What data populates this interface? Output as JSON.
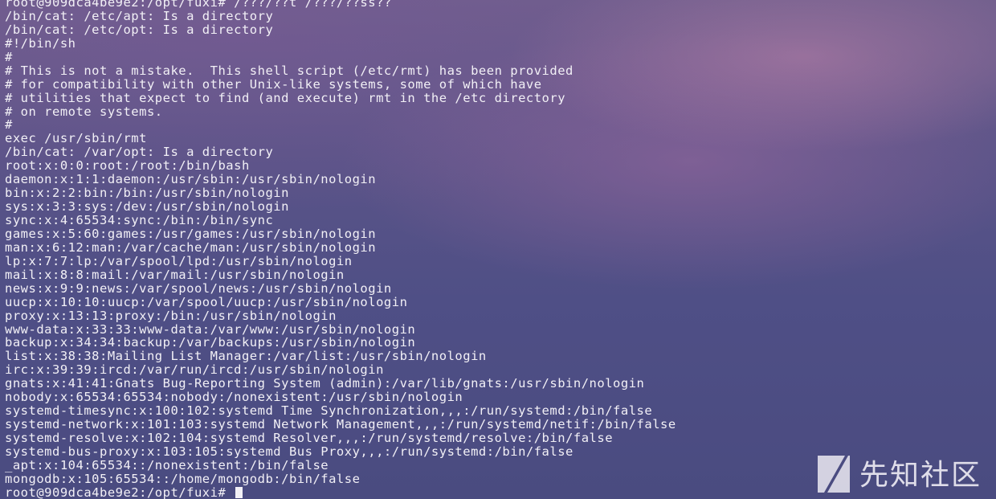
{
  "terminal": {
    "lines": [
      "root@909dca4be9e2:/opt/fuxi# /???/??t /???/??ss??",
      "/bin/cat: /etc/apt: Is a directory",
      "/bin/cat: /etc/opt: Is a directory",
      "#!/bin/sh",
      "#",
      "# This is not a mistake.  This shell script (/etc/rmt) has been provided",
      "# for compatibility with other Unix-like systems, some of which have",
      "# utilities that expect to find (and execute) rmt in the /etc directory",
      "# on remote systems.",
      "#",
      "exec /usr/sbin/rmt",
      "/bin/cat: /var/opt: Is a directory",
      "root:x:0:0:root:/root:/bin/bash",
      "daemon:x:1:1:daemon:/usr/sbin:/usr/sbin/nologin",
      "bin:x:2:2:bin:/bin:/usr/sbin/nologin",
      "sys:x:3:3:sys:/dev:/usr/sbin/nologin",
      "sync:x:4:65534:sync:/bin:/bin/sync",
      "games:x:5:60:games:/usr/games:/usr/sbin/nologin",
      "man:x:6:12:man:/var/cache/man:/usr/sbin/nologin",
      "lp:x:7:7:lp:/var/spool/lpd:/usr/sbin/nologin",
      "mail:x:8:8:mail:/var/mail:/usr/sbin/nologin",
      "news:x:9:9:news:/var/spool/news:/usr/sbin/nologin",
      "uucp:x:10:10:uucp:/var/spool/uucp:/usr/sbin/nologin",
      "proxy:x:13:13:proxy:/bin:/usr/sbin/nologin",
      "www-data:x:33:33:www-data:/var/www:/usr/sbin/nologin",
      "backup:x:34:34:backup:/var/backups:/usr/sbin/nologin",
      "list:x:38:38:Mailing List Manager:/var/list:/usr/sbin/nologin",
      "irc:x:39:39:ircd:/var/run/ircd:/usr/sbin/nologin",
      "gnats:x:41:41:Gnats Bug-Reporting System (admin):/var/lib/gnats:/usr/sbin/nologin",
      "nobody:x:65534:65534:nobody:/nonexistent:/usr/sbin/nologin",
      "systemd-timesync:x:100:102:systemd Time Synchronization,,,:/run/systemd:/bin/false",
      "systemd-network:x:101:103:systemd Network Management,,,:/run/systemd/netif:/bin/false",
      "systemd-resolve:x:102:104:systemd Resolver,,,:/run/systemd/resolve:/bin/false",
      "systemd-bus-proxy:x:103:105:systemd Bus Proxy,,,:/run/systemd:/bin/false",
      "_apt:x:104:65534::/nonexistent:/bin/false",
      "mongodb:x:105:65534::/home/mongodb:/bin/false"
    ],
    "prompt": "root@909dca4be9e2:/opt/fuxi# "
  },
  "watermark": {
    "text": "先知社区",
    "logo_icon": "xianzhi-logo-icon"
  },
  "colors": {
    "text": "#f2f0f6",
    "background_top": "#6e5e8c",
    "background_bottom": "#4a4b80"
  }
}
